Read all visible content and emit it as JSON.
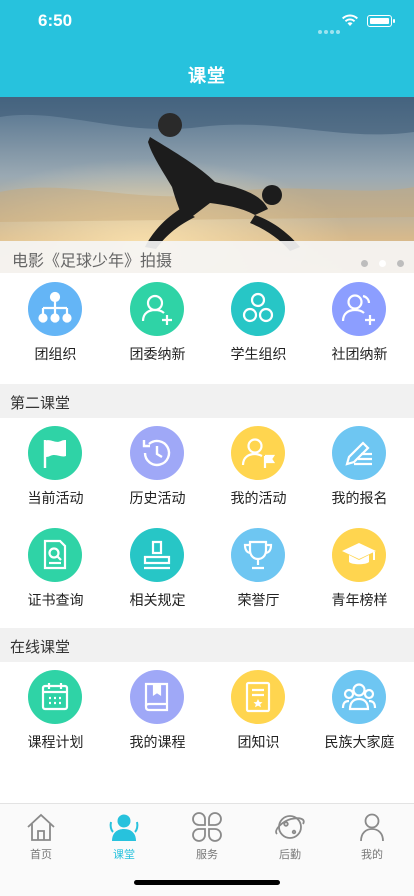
{
  "status": {
    "time": "6:50"
  },
  "nav": {
    "title": "课堂"
  },
  "banner": {
    "caption": "电影《足球少年》拍摄",
    "dots": 3,
    "active_dot": 1
  },
  "top_grid": [
    {
      "label": "团组织",
      "icon": "org-chart-icon",
      "color": "#64b5f6"
    },
    {
      "label": "团委纳新",
      "icon": "add-member-icon",
      "color": "#2fd3a6"
    },
    {
      "label": "学生组织",
      "icon": "group-icon",
      "color": "#27c6c6"
    },
    {
      "label": "社团纳新",
      "icon": "add-group-icon",
      "color": "#8c9eff"
    }
  ],
  "sections": [
    {
      "title": "第二课堂",
      "rows": [
        [
          {
            "label": "当前活动",
            "icon": "flag-icon",
            "color": "#2fd3a6"
          },
          {
            "label": "历史活动",
            "icon": "history-icon",
            "color": "#9fa8f7"
          },
          {
            "label": "我的活动",
            "icon": "user-flag-icon",
            "color": "#ffd54f"
          },
          {
            "label": "我的报名",
            "icon": "edit-list-icon",
            "color": "#6ec6f2"
          }
        ],
        [
          {
            "label": "证书查询",
            "icon": "certificate-search-icon",
            "color": "#2fd3a6"
          },
          {
            "label": "相关规定",
            "icon": "stamp-icon",
            "color": "#27c6c6"
          },
          {
            "label": "荣誉厅",
            "icon": "trophy-icon",
            "color": "#6ec6f2"
          },
          {
            "label": "青年榜样",
            "icon": "graduation-cap-icon",
            "color": "#ffd54f"
          }
        ]
      ]
    },
    {
      "title": "在线课堂",
      "rows": [
        [
          {
            "label": "课程计划",
            "icon": "calendar-icon",
            "color": "#2fd3a6"
          },
          {
            "label": "我的课程",
            "icon": "book-icon",
            "color": "#9fa8f7"
          },
          {
            "label": "团知识",
            "icon": "document-star-icon",
            "color": "#ffd54f"
          },
          {
            "label": "民族大家庭",
            "icon": "family-icon",
            "color": "#6ec6f2"
          }
        ]
      ]
    }
  ],
  "tabbar": [
    {
      "label": "首页",
      "icon": "home-icon",
      "active": false
    },
    {
      "label": "课堂",
      "icon": "classroom-icon",
      "active": true
    },
    {
      "label": "服务",
      "icon": "service-icon",
      "active": false
    },
    {
      "label": "后勤",
      "icon": "planet-icon",
      "active": false
    },
    {
      "label": "我的",
      "icon": "profile-icon",
      "active": false
    }
  ],
  "colors": {
    "brand": "#27c2dd",
    "section_bg": "#f1f1f1"
  }
}
